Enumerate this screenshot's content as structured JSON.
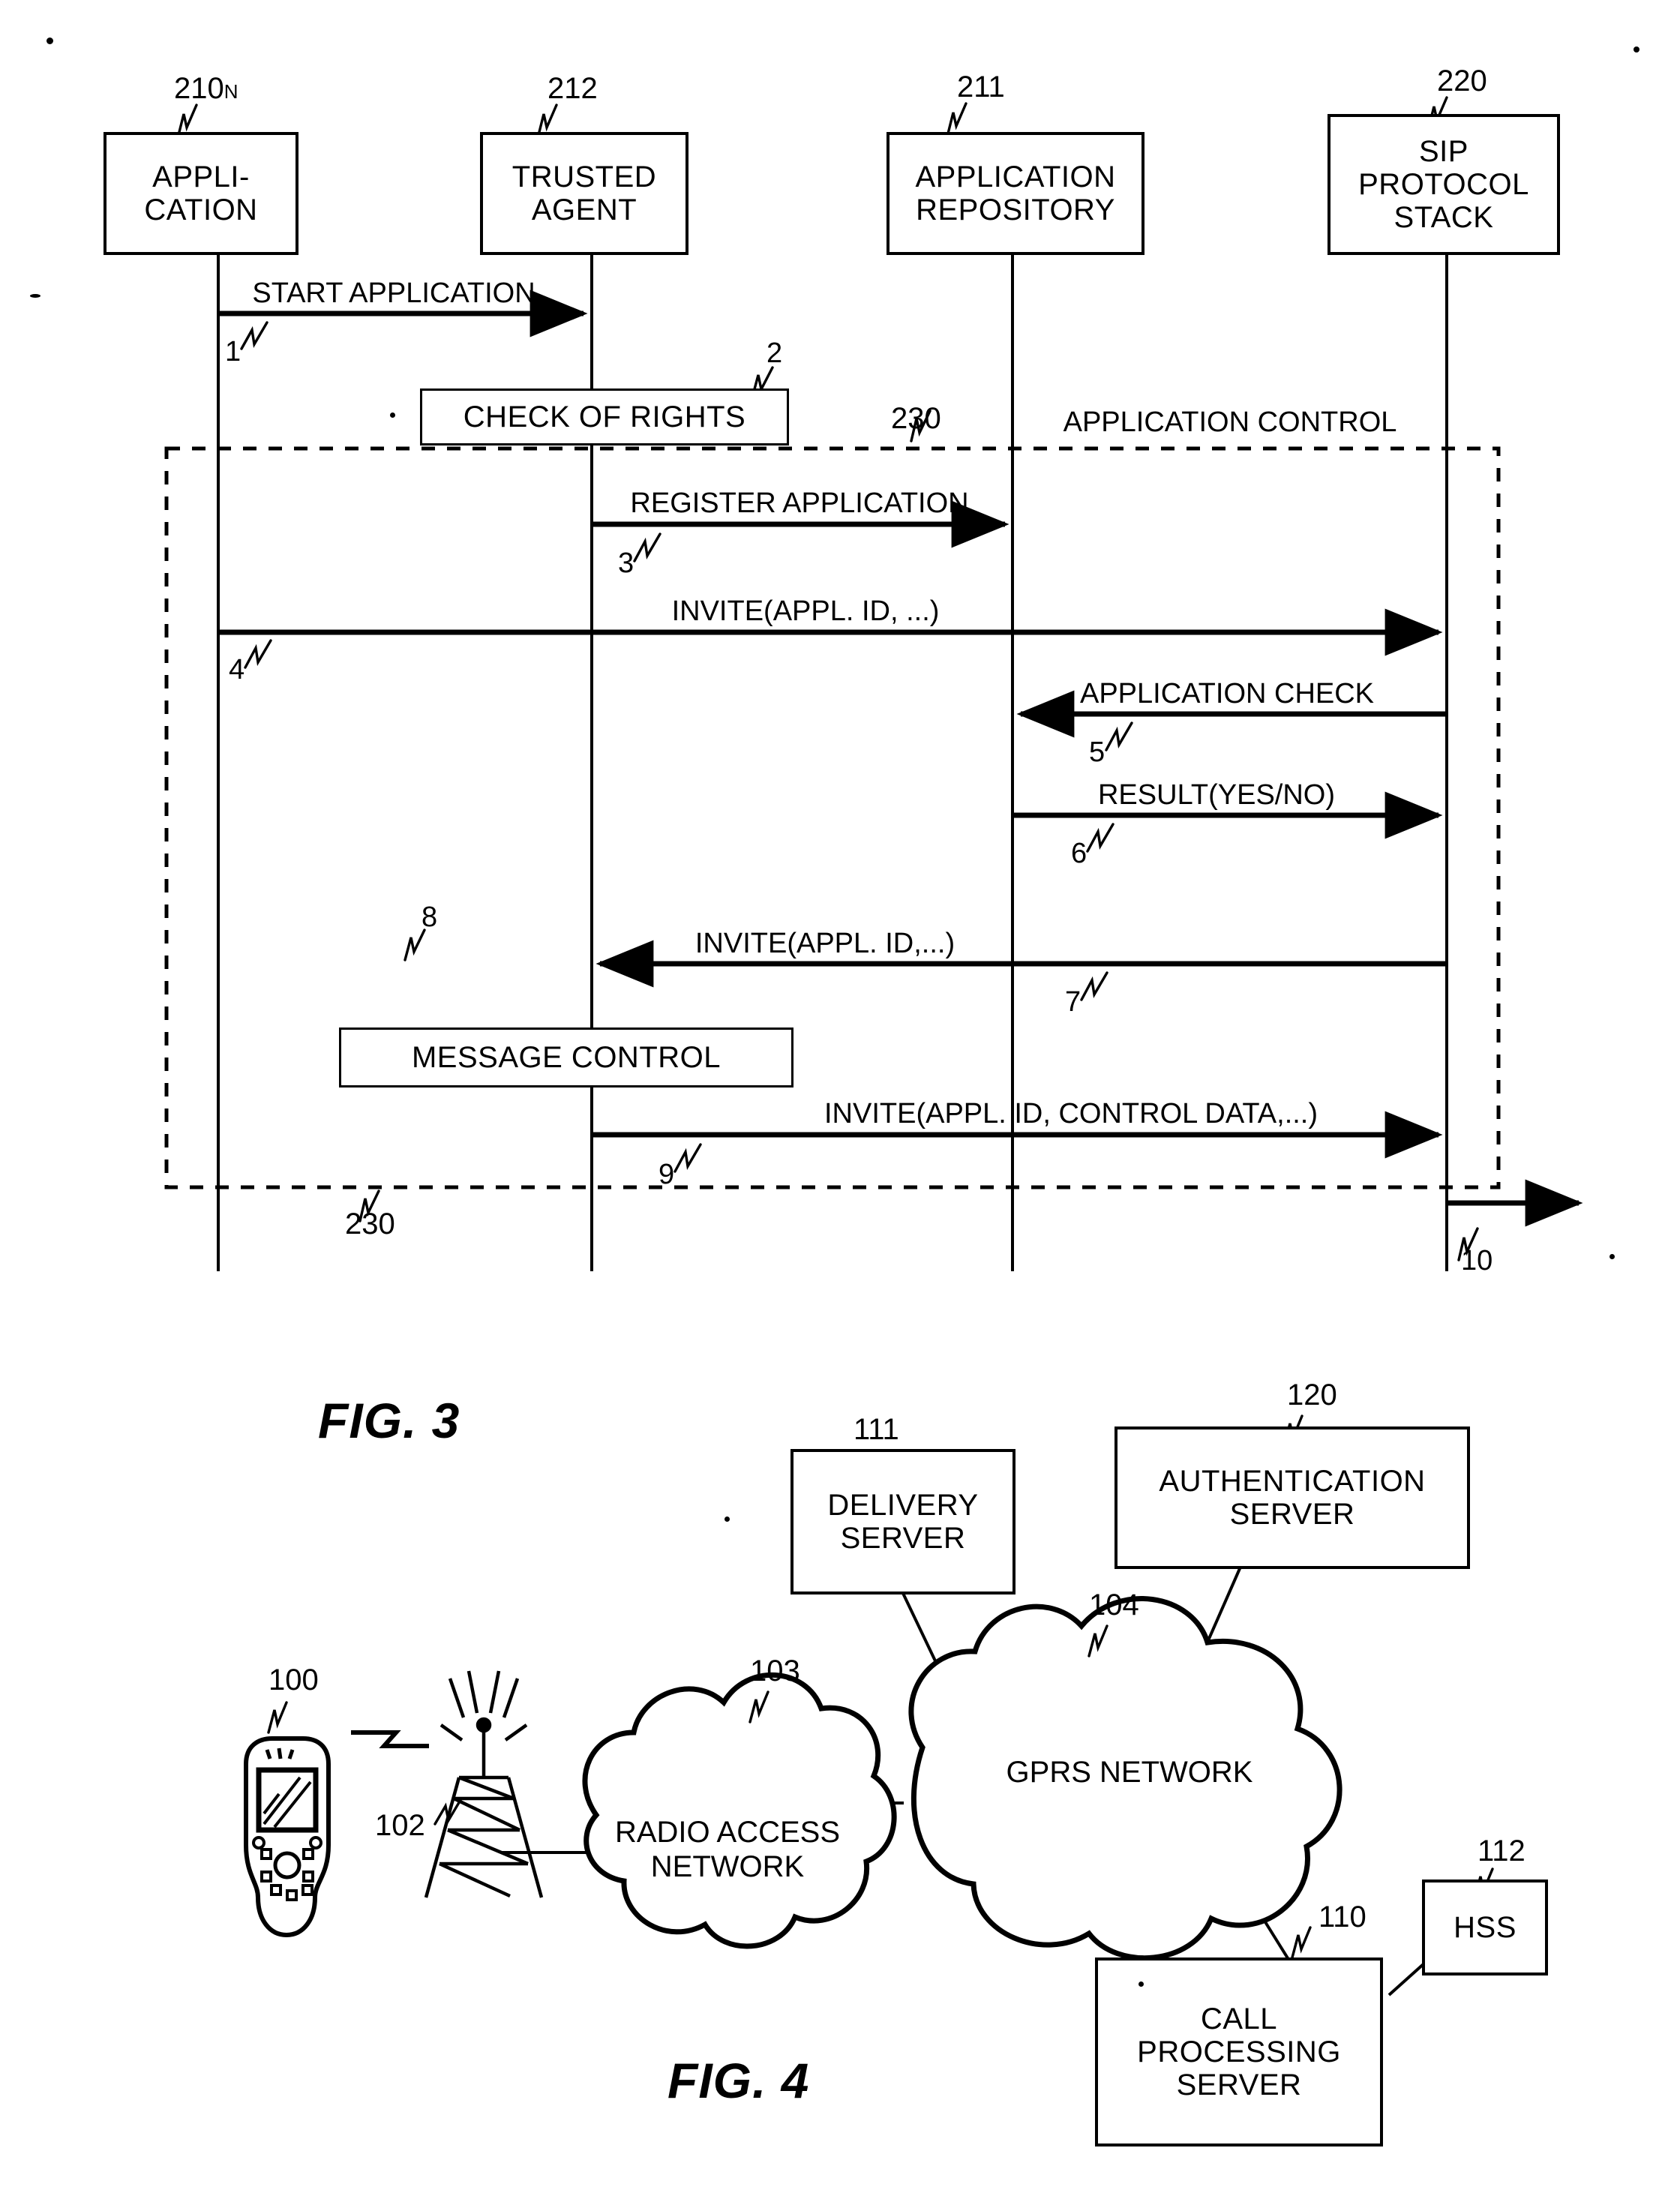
{
  "figures": [
    {
      "caption": "FIG. 3",
      "type": "sequence-diagram",
      "lifelines": [
        {
          "ref": "210",
          "ref_sub": "N",
          "label": "APPLI-\nCATION"
        },
        {
          "ref": "212",
          "ref_sub": "",
          "label": "TRUSTED\nAGENT"
        },
        {
          "ref": "211",
          "ref_sub": "",
          "label": "APPLICATION\nREPOSITORY"
        },
        {
          "ref": "220",
          "ref_sub": "",
          "label": "SIP\nPROTOCOL\nSTACK"
        }
      ],
      "messages": [
        {
          "num": "1",
          "text": "START APPLICATION",
          "from": "APPLICATION",
          "to": "TRUSTED AGENT",
          "dir": "right"
        },
        {
          "num": "3",
          "text": "REGISTER APPLICATION",
          "from": "TRUSTED AGENT",
          "to": "APPLICATION REPOSITORY",
          "dir": "right"
        },
        {
          "num": "4",
          "text": "INVITE(APPL. ID, ...)",
          "from": "APPLICATION",
          "to": "SIP PROTOCOL STACK",
          "dir": "right"
        },
        {
          "num": "5",
          "text": "APPLICATION CHECK",
          "from": "SIP PROTOCOL STACK",
          "to": "APPLICATION REPOSITORY",
          "dir": "left"
        },
        {
          "num": "6",
          "text": "RESULT(YES/NO)",
          "from": "APPLICATION REPOSITORY",
          "to": "SIP PROTOCOL STACK",
          "dir": "right"
        },
        {
          "num": "7",
          "text": "INVITE(APPL. ID,...)",
          "from": "SIP PROTOCOL STACK",
          "to": "TRUSTED AGENT",
          "dir": "left"
        },
        {
          "num": "9",
          "text": "INVITE(APPL. ID, CONTROL DATA,...)",
          "from": "TRUSTED AGENT",
          "to": "SIP PROTOCOL STACK",
          "dir": "right"
        },
        {
          "num": "10",
          "text": "",
          "from": "SIP PROTOCOL STACK",
          "to": "outside",
          "dir": "right"
        }
      ],
      "activities": [
        {
          "num": "2",
          "label": "CHECK OF RIGHTS"
        },
        {
          "num": "8",
          "label": "MESSAGE CONTROL"
        }
      ],
      "region": {
        "label": "APPLICATION CONTROL",
        "ref_top": "230",
        "ref_bottom": "230"
      }
    },
    {
      "caption": "FIG. 4",
      "type": "network-diagram",
      "nodes": [
        {
          "ref": "100",
          "label": "",
          "kind": "mobile-phone"
        },
        {
          "ref": "102",
          "label": "",
          "kind": "base-station"
        },
        {
          "ref": "103",
          "label": "RADIO ACCESS\nNETWORK",
          "kind": "cloud"
        },
        {
          "ref": "104",
          "label": "GPRS NETWORK",
          "kind": "cloud"
        },
        {
          "ref": "111",
          "label": "DELIVERY\nSERVER",
          "kind": "box"
        },
        {
          "ref": "120",
          "label": "AUTHENTICATION\nSERVER",
          "kind": "box"
        },
        {
          "ref": "110",
          "label": "CALL\nPROCESSING\nSERVER",
          "kind": "box"
        },
        {
          "ref": "112",
          "label": "HSS",
          "kind": "box"
        }
      ]
    }
  ]
}
